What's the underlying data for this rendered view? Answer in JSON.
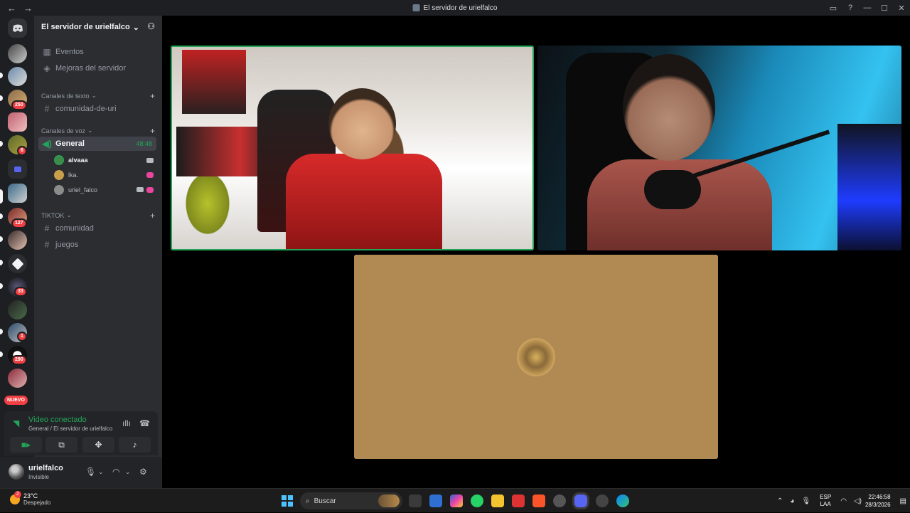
{
  "window": {
    "title": "El servidor de urielfalco",
    "back": "←",
    "forward": "→",
    "inbox_icon": "inbox-icon",
    "help_icon": "help-icon",
    "minimize": "—",
    "maximize": "☐",
    "close": "✕"
  },
  "rail": {
    "badges": [
      "250",
      "6",
      "127",
      "33",
      "1",
      "290"
    ],
    "new_label": "NUEVO"
  },
  "server": {
    "name": "El servidor de urielfalco",
    "chevron": "⌄",
    "add_member_icon": "add-member-icon",
    "top_items": [
      {
        "icon": "calendar-icon",
        "glyph": "▦",
        "label": "Eventos"
      },
      {
        "icon": "boost-icon",
        "glyph": "◈",
        "label": "Mejoras del servidor"
      }
    ],
    "categories": {
      "text": "Canales de texto",
      "voice": "Canales de voz",
      "tiktok": "TIKTOK"
    },
    "text_channels": [
      "comunidad-de-uri"
    ],
    "voice_channel": {
      "name": "General",
      "timer": "48:48"
    },
    "voice_users": [
      {
        "name": "alvaaa",
        "avatar": "#3f8a4a"
      },
      {
        "name": "lka.",
        "avatar": "#c9a04a"
      },
      {
        "name": "uriel_falco",
        "avatar": "#8b8b8b"
      }
    ],
    "tiktok_channels": [
      "comunidad",
      "juegos"
    ]
  },
  "voice_panel": {
    "status": "Video conectado",
    "location": "General / El servidor de urielfalco",
    "buttons": [
      "camera",
      "share-screen",
      "activities",
      "soundboard"
    ]
  },
  "user": {
    "name": "urielfalco",
    "status": "Invisible"
  },
  "taskbar": {
    "temp": "23°C",
    "weather": "Despejado",
    "weather_badge": "2",
    "search_placeholder": "Buscar",
    "lang_top": "ESP",
    "lang_bottom": "LAA",
    "time": "22:46:58",
    "date": "28/3/2026"
  }
}
